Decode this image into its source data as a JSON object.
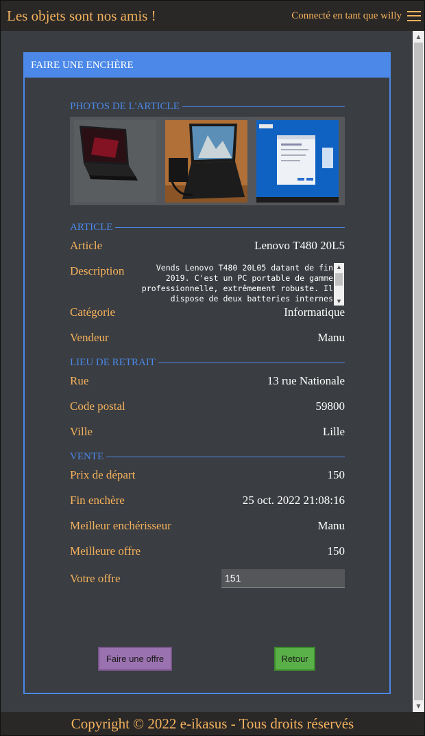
{
  "header": {
    "site_title": "Les objets sont nos amis !",
    "user_text": "Connecté en tant que willy",
    "menu_icon": "hamburger-menu-icon"
  },
  "card": {
    "title": "FAIRE UNE ENCHÈRE",
    "accent_color": "#4b88e8"
  },
  "photos": {
    "section_title": "PHOTOS DE L'ARTICLE"
  },
  "article": {
    "section_title": "ARTICLE",
    "name_label": "Article",
    "name_value": "Lenovo T480 20L5",
    "description_label": "Description",
    "description_value": "Vends Lenovo T480 20L05 datant de fin 2019. C'est un PC portable de gamme professionnelle, extrêmement robuste. Il dispose de deux batteries internes",
    "category_label": "Catégorie",
    "category_value": "Informatique",
    "seller_label": "Vendeur",
    "seller_value": "Manu"
  },
  "pickup": {
    "section_title": "LIEU DE RETRAIT",
    "street_label": "Rue",
    "street_value": "13 rue Nationale",
    "postal_label": "Code postal",
    "postal_value": "59800",
    "city_label": "Ville",
    "city_value": "Lille"
  },
  "sale": {
    "section_title": "VENTE",
    "start_price_label": "Prix de départ",
    "start_price_value": "150",
    "end_label": "Fin enchère",
    "end_value": "25 oct. 2022 21:08:16",
    "best_bidder_label": "Meilleur enchérisseur",
    "best_bidder_value": "Manu",
    "best_offer_label": "Meilleure offre",
    "best_offer_value": "150",
    "your_offer_label": "Votre offre",
    "your_offer_value": "151"
  },
  "buttons": {
    "offer_label": "Faire une offre",
    "back_label": "Retour",
    "offer_color": "#9b72b0",
    "back_color": "#5ab048"
  },
  "footer": {
    "text": "Copyright © 2022 e-ikasus - Tous droits réservés"
  }
}
